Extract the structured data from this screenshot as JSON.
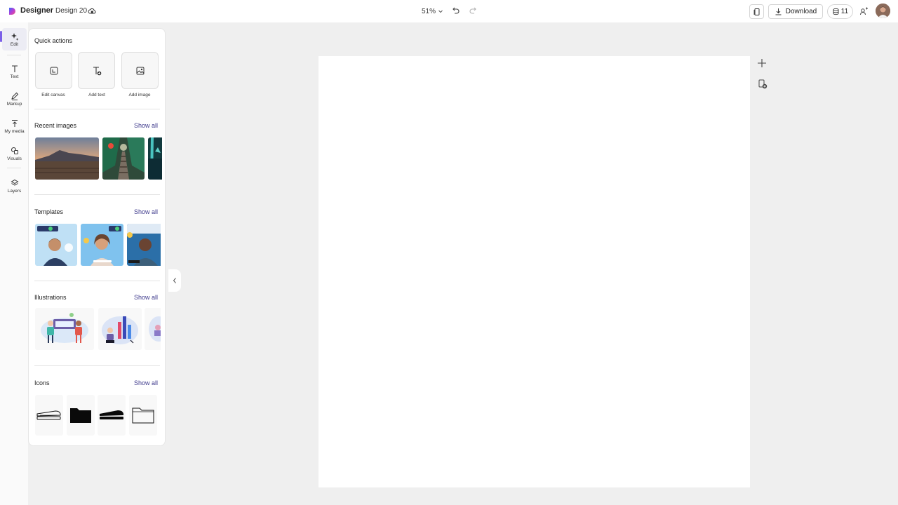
{
  "app": {
    "name": "Designer",
    "document": "Design 20"
  },
  "toolbar": {
    "zoom": "51%",
    "download_label": "Download",
    "credits": "11"
  },
  "rail": {
    "items": [
      {
        "label": "Edit",
        "icon": "sparkle-edit-icon"
      },
      {
        "label": "Text",
        "icon": "text-icon"
      },
      {
        "label": "Markup",
        "icon": "pen-icon"
      },
      {
        "label": "My media",
        "icon": "upload-icon"
      },
      {
        "label": "Visuals",
        "icon": "shapes-icon"
      },
      {
        "label": "Layers",
        "icon": "layers-icon"
      }
    ]
  },
  "panel": {
    "quick_actions": {
      "title": "Quick actions",
      "items": [
        {
          "label": "Edit canvas",
          "icon": "resize-canvas-icon"
        },
        {
          "label": "Add text",
          "icon": "add-text-icon"
        },
        {
          "label": "Add image",
          "icon": "add-image-icon"
        }
      ]
    },
    "recent_images": {
      "title": "Recent images",
      "show_all": "Show all"
    },
    "templates": {
      "title": "Templates",
      "show_all": "Show all"
    },
    "illustrations": {
      "title": "Illustrations",
      "show_all": "Show all"
    },
    "icons": {
      "title": "Icons",
      "show_all": "Show all"
    }
  },
  "colors": {
    "accent": "#7b5fe8",
    "link": "#3e3a8c",
    "canvas": "#ffffff",
    "workspace": "#efefef"
  }
}
